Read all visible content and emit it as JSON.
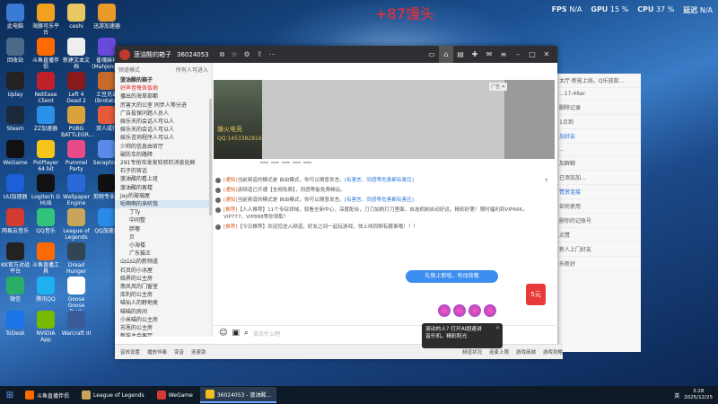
{
  "overlay": {
    "fps_label": "FPS",
    "fps_value": "N/A",
    "gpu_label": "GPU",
    "gpu_value": "15 %",
    "cpu_label": "CPU",
    "cpu_value": "37 %",
    "latency_label": "延迟",
    "latency_value": "N/A",
    "gift_text": "+87馒头"
  },
  "desktop_icons": [
    {
      "label": "此电脑",
      "color": "#3a7bd5"
    },
    {
      "label": "回收站",
      "color": "#4a6a8a"
    },
    {
      "label": "Uplay",
      "color": "#222222"
    },
    {
      "label": "Steam",
      "color": "#1b2838"
    },
    {
      "label": "WeGame",
      "color": "#111111"
    },
    {
      "label": "UU加速器",
      "color": "#1d5fd6"
    },
    {
      "label": "网易云音乐",
      "color": "#d33a31"
    },
    {
      "label": "KK官方对战平台",
      "color": "#222222"
    },
    {
      "label": "微信",
      "color": "#2aae67"
    },
    {
      "label": "ToDesk",
      "color": "#1a74e8"
    },
    {
      "label": "海豚可乐平台",
      "color": "#f2a11f"
    },
    {
      "label": "斗鱼直播伴侣",
      "color": "#ff6a00"
    },
    {
      "label": "NetEase Client",
      "color": "#c0202a"
    },
    {
      "label": "ZZ加速器",
      "color": "#2a90e8"
    },
    {
      "label": "PotPlayer 64 bit",
      "color": "#f5c518"
    },
    {
      "label": "Logitech G HUB",
      "color": "#111111"
    },
    {
      "label": "QQ音乐",
      "color": "#31c27c"
    },
    {
      "label": "斗鱼直播工具",
      "color": "#ff6a00"
    },
    {
      "label": "腾讯QQ",
      "color": "#1eb0f0"
    },
    {
      "label": "NVIDIA App",
      "color": "#76b900"
    },
    {
      "label": "ceshi",
      "color": "#e8c860"
    },
    {
      "label": "新建文本文档",
      "color": "#eeeeee"
    },
    {
      "label": "Left 4 Dead 2",
      "color": "#8a1a1a"
    },
    {
      "label": "PUBG BATTLEGR...",
      "color": "#d9a23a"
    },
    {
      "label": "Pummel Party",
      "color": "#e84a8a"
    },
    {
      "label": "Wallpaper Engine",
      "color": "#2a6ad8"
    },
    {
      "label": "League of Legends",
      "color": "#c8a55a"
    },
    {
      "label": "Dread Hunger",
      "color": "#334455"
    },
    {
      "label": "Goose Goose Duck",
      "color": "#ffffff"
    },
    {
      "label": "Warcraft III",
      "color": "#3a5a9a"
    },
    {
      "label": "迅游加速器",
      "color": "#e89a2a"
    },
    {
      "label": "雀魂麻将(Mahjong...",
      "color": "#6a4ad8"
    },
    {
      "label": "土豆兄弟(Brotato)",
      "color": "#c86a2a"
    },
    {
      "label": "双人成行",
      "color": "#e85a3a"
    },
    {
      "label": "Seraphine",
      "color": "#5a8ae8"
    },
    {
      "label": "剪映专业版",
      "color": "#111111"
    },
    {
      "label": "QQ加速器",
      "color": "#2a8ae8"
    }
  ],
  "window": {
    "channel_name": "菠油酸的箱子",
    "channel_id": "36024053",
    "sidebar_header": "频道模式",
    "sidebar_search": "所有人可进入",
    "sidebar_items": [
      {
        "label": "菠油酸的箱子",
        "style": "bold"
      },
      {
        "label": "好声音每各饭地",
        "style": "red"
      },
      {
        "label": "播出的海草部都",
        "style": ""
      },
      {
        "label": "厉害大的公室 同步人等分进",
        "style": ""
      },
      {
        "label": "广告投保问题人员人",
        "style": ""
      },
      {
        "label": "娱乐天的会话人可以人",
        "style": ""
      },
      {
        "label": "娱乐天的会话人可以人",
        "style": ""
      },
      {
        "label": "娱乐咨询程序人可以人",
        "style": ""
      },
      {
        "label": "少帅的信息由官厅",
        "style": ""
      },
      {
        "label": "破防车的路障",
        "style": ""
      },
      {
        "label": "291专抢攻发发较验的消息处群",
        "style": ""
      },
      {
        "label": "石子的官话",
        "style": ""
      },
      {
        "label": "菠油酸的看上班",
        "style": ""
      },
      {
        "label": "菠油酸的客楼",
        "style": ""
      },
      {
        "label": "Jay的玻璃屋",
        "style": ""
      },
      {
        "label": "呃啊啊的来听我",
        "style": "sel"
      },
      {
        "label": "丁Ty",
        "style": "sub"
      },
      {
        "label": "中间整",
        "style": "sub"
      },
      {
        "label": "胖嘟",
        "style": "sub"
      },
      {
        "label": "贝",
        "style": "sub"
      },
      {
        "label": "小海楼",
        "style": "sub"
      },
      {
        "label": "广东猫王",
        "style": "sub"
      },
      {
        "label": "山山山的新频道",
        "style": ""
      },
      {
        "label": "石页的小冰屋",
        "style": ""
      },
      {
        "label": "临界的公主房",
        "style": ""
      },
      {
        "label": "燕凤风的门窗室",
        "style": ""
      },
      {
        "label": "库利的公主房",
        "style": ""
      },
      {
        "label": "喵仙人的野地类",
        "style": ""
      },
      {
        "label": "喵喵的房间",
        "style": ""
      },
      {
        "label": "小米喵的公主房",
        "style": ""
      },
      {
        "label": "苏恩的公主房",
        "style": ""
      },
      {
        "label": "新装主会客厅",
        "style": ""
      },
      {
        "label": "柔宝的绵绵小厅",
        "style": ""
      },
      {
        "label": "山山山的新频道",
        "style": ""
      }
    ],
    "video_thumb_title": "嫌火电竞",
    "video_thumb_qq": "QQ:1453382816",
    "video_label": "广告 ✕",
    "messages": [
      {
        "tag": "[通知]",
        "text": "当前频道的模式是 自由模式，你可以随意发言。",
        "link": "[有害言、同感等危害都有害应]"
      },
      {
        "tag": "[通知]",
        "text": "该频道已开通【全频免费】，同感等能免费畅玩。",
        "link": ""
      },
      {
        "tag": "[通知]",
        "text": "当前频道的模式是 自由模式，你可以随意发言。",
        "link": "[有害言、同感等危害都有害应]"
      },
      {
        "tag": "[推荐]",
        "text": "【人人推荐】11个专综领域，就看全新中心，深度配合，刀刀加刷打刀里面，自选机制自动好运，精彩好第！限时福利到VIP666，VIP777，VIP888等你领取！",
        "link": ""
      },
      {
        "tag": "[推荐]",
        "text": "【今日推荐】欢迎您进入频道，好友之间一起玩游戏，快上线同聊有趣事哦！！！",
        "link": ""
      }
    ],
    "input_placeholder": "说点什么吧",
    "gift_badge": "5元",
    "tip_blue": "礼物上新啦，有动效哦",
    "tip_dark_line1": "滚动的人?  打开AI超避讲",
    "tip_dark_line2": "音乐机，精彩阳光",
    "status_items": [
      "音效设置",
      "播放伴奏",
      "变音",
      "连麦助"
    ],
    "status_right": [
      "频道状况",
      "连麦上限",
      "游戏商城",
      "游戏攻略"
    ]
  },
  "bg_chat": {
    "rows": [
      "太厅·新能上线，Q乐放款...",
      "...17:46ar",
      "删除记录",
      "1点到",
      "...",
      "加群聊",
      "已添加加...",
      "如何使用",
      "删你的记账号",
      "点赞",
      "新人上门好友",
      "乐新好"
    ],
    "links": [
      "加好友",
      "赞赏连接"
    ]
  },
  "taskbar": {
    "apps": [
      {
        "label": "斗鱼直播伴侣",
        "color": "#ff6a00",
        "active": false
      },
      {
        "label": "League of Legends",
        "color": "#c8a55a",
        "active": false
      },
      {
        "label": "WeGame",
        "color": "#d33a31",
        "active": false
      },
      {
        "label": "36024053 - 菠油酸...",
        "color": "#f0c020",
        "active": true
      }
    ],
    "lang": "英",
    "time": "3:28",
    "date": "2025/12/25"
  }
}
